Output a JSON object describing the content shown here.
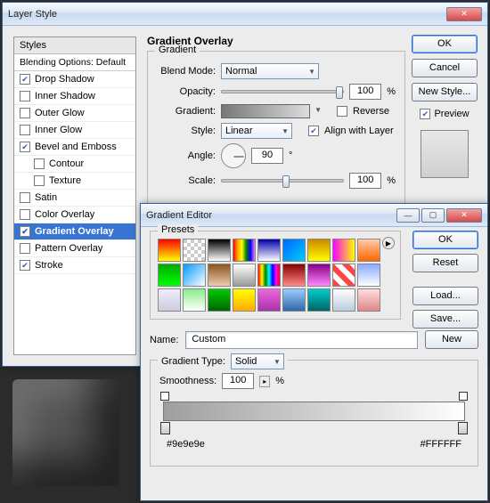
{
  "layerStyle": {
    "title": "Layer Style",
    "stylesHeader": "Styles",
    "blendingOptions": "Blending Options: Default",
    "items": [
      {
        "label": "Drop Shadow",
        "checked": true,
        "indent": false
      },
      {
        "label": "Inner Shadow",
        "checked": false,
        "indent": false
      },
      {
        "label": "Outer Glow",
        "checked": false,
        "indent": false
      },
      {
        "label": "Inner Glow",
        "checked": false,
        "indent": false
      },
      {
        "label": "Bevel and Emboss",
        "checked": true,
        "indent": false
      },
      {
        "label": "Contour",
        "checked": false,
        "indent": true
      },
      {
        "label": "Texture",
        "checked": false,
        "indent": true
      },
      {
        "label": "Satin",
        "checked": false,
        "indent": false
      },
      {
        "label": "Color Overlay",
        "checked": false,
        "indent": false
      },
      {
        "label": "Gradient Overlay",
        "checked": true,
        "indent": false,
        "selected": true
      },
      {
        "label": "Pattern Overlay",
        "checked": false,
        "indent": false
      },
      {
        "label": "Stroke",
        "checked": true,
        "indent": false
      }
    ],
    "section": {
      "title": "Gradient Overlay",
      "legend": "Gradient",
      "blendModeLabel": "Blend Mode:",
      "blendMode": "Normal",
      "opacityLabel": "Opacity:",
      "opacity": "100",
      "pct": "%",
      "gradientLabel": "Gradient:",
      "reverseLabel": "Reverse",
      "styleLabel": "Style:",
      "style": "Linear",
      "alignLabel": "Align with Layer",
      "angleLabel": "Angle:",
      "angle": "90",
      "deg": "°",
      "scaleLabel": "Scale:",
      "scale": "100"
    },
    "buttons": {
      "ok": "OK",
      "cancel": "Cancel",
      "newStyle": "New Style...",
      "previewLabel": "Preview"
    }
  },
  "gradientEditor": {
    "title": "Gradient Editor",
    "presetsLegend": "Presets",
    "presets": [
      "linear-gradient(#ff0000,#ffff00)",
      "repeating-conic-gradient(#fff 0 25%,#ccc 0 50%) 0/8px 8px",
      "linear-gradient(#000,#fff)",
      "linear-gradient(90deg,red,orange,yellow,green,blue,violet)",
      "linear-gradient(#00a,#fff)",
      "linear-gradient(135deg,#06f,#0cf)",
      "linear-gradient(#c80,#ff0)",
      "linear-gradient(90deg,#f0f,#ff0)",
      "linear-gradient(#fca,#f60)",
      "linear-gradient(#0a0,#0f0)",
      "linear-gradient(135deg,#09f,#fff)",
      "linear-gradient(#852,#eca)",
      "linear-gradient(#fff,#999)",
      "linear-gradient(90deg,red,yellow,green,cyan,blue,magenta,red)",
      "linear-gradient(#800,#f88)",
      "linear-gradient(#808,#f8f)",
      "repeating-linear-gradient(45deg,#f44 0 6px,#fff 6px 12px)",
      "linear-gradient(#8af,#fff)",
      "linear-gradient(#eef,#ccd)",
      "linear-gradient(#8e8,#fff)",
      "linear-gradient(#0c0,#060)",
      "linear-gradient(#ff0,#fa0)",
      "linear-gradient(#e6d,#a3a)",
      "linear-gradient(#9cf,#36a)",
      "linear-gradient(#0cc,#066)",
      "linear-gradient(#fff,#bcd)",
      "linear-gradient(#fdd,#d88)"
    ],
    "buttons": {
      "ok": "OK",
      "reset": "Reset",
      "load": "Load...",
      "save": "Save...",
      "new": "New"
    },
    "nameLabel": "Name:",
    "name": "Custom",
    "gradientTypeLabel": "Gradient Type:",
    "gradientType": "Solid",
    "smoothnessLabel": "Smoothness:",
    "smoothness": "100",
    "pct": "%",
    "leftColor": "#9e9e9e",
    "rightColor": "#FFFFFF"
  }
}
